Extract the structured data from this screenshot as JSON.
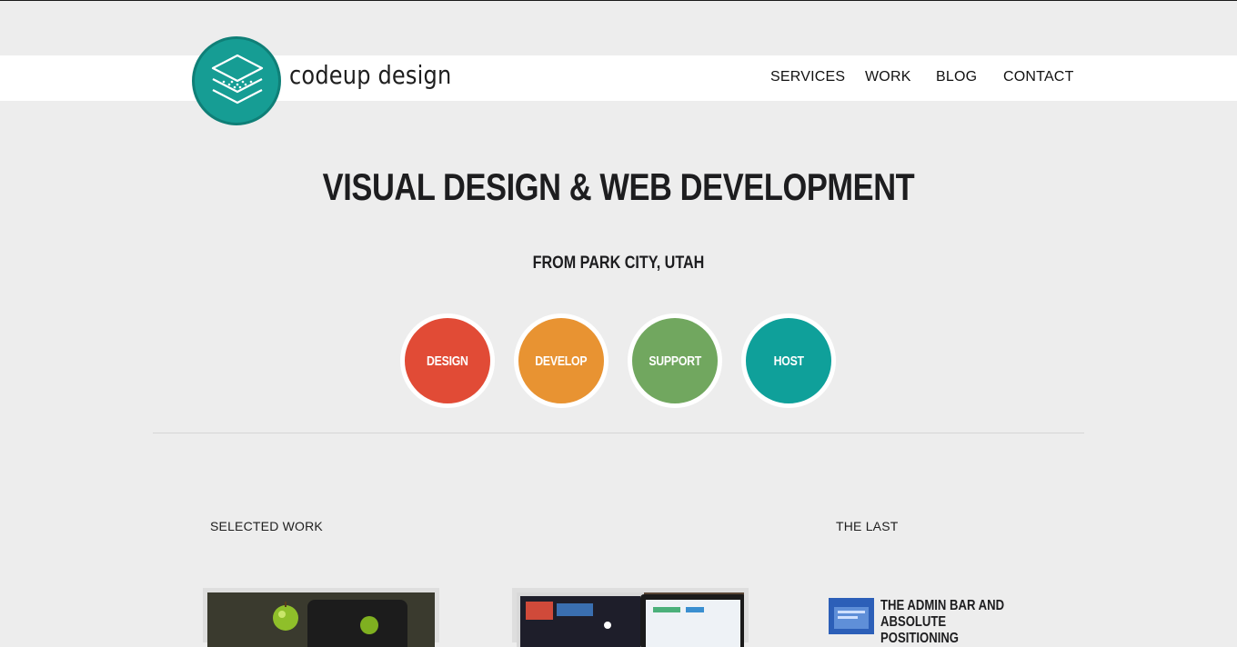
{
  "brand": {
    "name": "codeup design",
    "logo_icon": "stacked-layers-icon"
  },
  "nav": {
    "items": [
      "SERVICES",
      "WORK",
      "BLOG",
      "CONTACT"
    ]
  },
  "hero": {
    "title": "VISUAL DESIGN & WEB DEVELOPMENT",
    "subtitle": "FROM PARK CITY, UTAH"
  },
  "services": [
    {
      "label": "DESIGN",
      "color": "#e14b36"
    },
    {
      "label": "DEVELOP",
      "color": "#e89332"
    },
    {
      "label": "SUPPORT",
      "color": "#71a75f"
    },
    {
      "label": "HOST",
      "color": "#0fa09a"
    }
  ],
  "sections": {
    "selected_work": "SELECTED WORK",
    "the_last": "THE LAST"
  },
  "latest_post": {
    "title": "THE ADMIN BAR AND ABSOLUTE POSITIONING"
  }
}
